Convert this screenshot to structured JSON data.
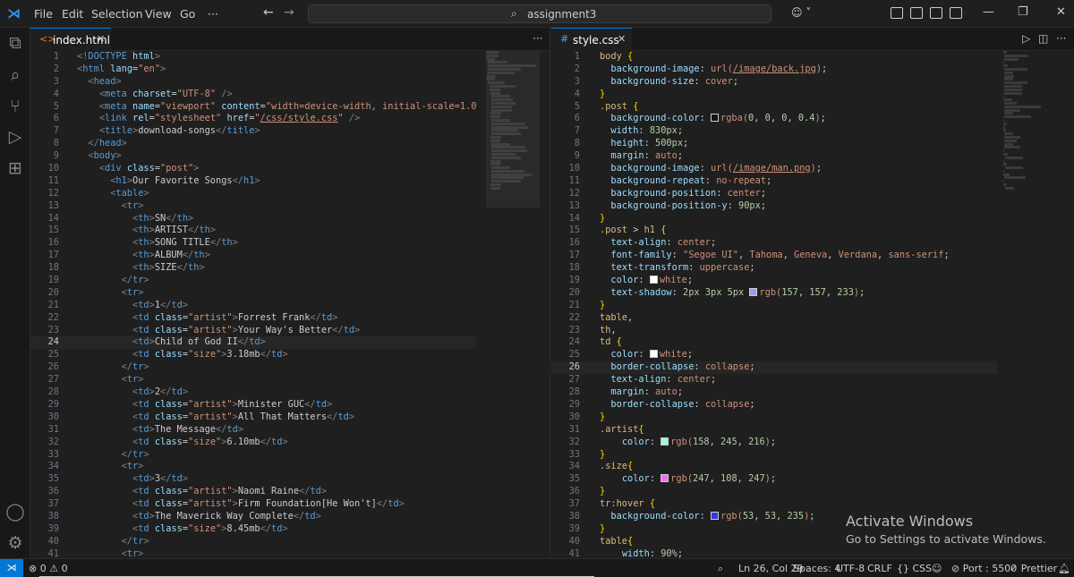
{
  "titlebar": {
    "menu": [
      "File",
      "Edit",
      "Selection",
      "View",
      "Go"
    ],
    "more": "···",
    "search_text": "assignment3",
    "back": "←",
    "forward": "→",
    "controls": {
      "minimize": "—",
      "restore": "❐",
      "close": "✕"
    }
  },
  "left_editor": {
    "tab_label": "index.html",
    "actions": "···",
    "lines": [
      {
        "n": "1",
        "html": "<span class='p'>&lt;!</span><span class='t'>DOCTYPE</span> <span class='a'>html</span><span class='p'>&gt;</span>"
      },
      {
        "n": "2",
        "html": "<span class='p'>&lt;</span><span class='t'>html</span> <span class='a'>lang</span><span class='x'>=</span><span class='s'>\"en\"</span><span class='p'>&gt;</span>"
      },
      {
        "n": "3",
        "html": "  <span class='p'>&lt;</span><span class='t'>head</span><span class='p'>&gt;</span>"
      },
      {
        "n": "4",
        "html": "    <span class='p'>&lt;</span><span class='t'>meta</span> <span class='a'>charset</span><span class='x'>=</span><span class='s'>\"UTF-8\"</span> <span class='p'>/&gt;</span>"
      },
      {
        "n": "5",
        "html": "    <span class='p'>&lt;</span><span class='t'>meta</span> <span class='a'>name</span><span class='x'>=</span><span class='s'>\"viewport\"</span> <span class='a'>content</span><span class='x'>=</span><span class='s'>\"width=device-width, initial-scale=1.0\"</span> <span class='p'>/&gt;</span>"
      },
      {
        "n": "6",
        "html": "    <span class='p'>&lt;</span><span class='t'>link</span> <span class='a'>rel</span><span class='x'>=</span><span class='s'>\"stylesheet\"</span> <span class='a'>href</span><span class='x'>=</span><span class='s'>\"<u>/css/style.css</u>\"</span> <span class='p'>/&gt;</span>"
      },
      {
        "n": "7",
        "html": "    <span class='p'>&lt;</span><span class='t'>title</span><span class='p'>&gt;</span><span class='x'>download-songs</span><span class='p'>&lt;/</span><span class='t'>title</span><span class='p'>&gt;</span>"
      },
      {
        "n": "8",
        "html": "  <span class='p'>&lt;/</span><span class='t'>head</span><span class='p'>&gt;</span>"
      },
      {
        "n": "9",
        "html": "  <span class='p'>&lt;</span><span class='t'>body</span><span class='p'>&gt;</span>"
      },
      {
        "n": "10",
        "html": "    <span class='p'>&lt;</span><span class='t'>div</span> <span class='a'>class</span><span class='x'>=</span><span class='s'>\"post\"</span><span class='p'>&gt;</span>"
      },
      {
        "n": "11",
        "html": "      <span class='p'>&lt;</span><span class='t'>h1</span><span class='p'>&gt;</span><span class='x'>Our Favorite Songs</span><span class='p'>&lt;/</span><span class='t'>h1</span><span class='p'>&gt;</span>"
      },
      {
        "n": "12",
        "html": "      <span class='p'>&lt;</span><span class='t'>table</span><span class='p'>&gt;</span>"
      },
      {
        "n": "13",
        "html": "        <span class='p'>&lt;</span><span class='t'>tr</span><span class='p'>&gt;</span>"
      },
      {
        "n": "14",
        "html": "          <span class='p'>&lt;</span><span class='t'>th</span><span class='p'>&gt;</span><span class='x'>SN</span><span class='p'>&lt;/</span><span class='t'>th</span><span class='p'>&gt;</span>"
      },
      {
        "n": "15",
        "html": "          <span class='p'>&lt;</span><span class='t'>th</span><span class='p'>&gt;</span><span class='x'>ARTIST</span><span class='p'>&lt;/</span><span class='t'>th</span><span class='p'>&gt;</span>"
      },
      {
        "n": "16",
        "html": "          <span class='p'>&lt;</span><span class='t'>th</span><span class='p'>&gt;</span><span class='x'>SONG TITLE</span><span class='p'>&lt;/</span><span class='t'>th</span><span class='p'>&gt;</span>"
      },
      {
        "n": "17",
        "html": "          <span class='p'>&lt;</span><span class='t'>th</span><span class='p'>&gt;</span><span class='x'>ALBUM</span><span class='p'>&lt;/</span><span class='t'>th</span><span class='p'>&gt;</span>"
      },
      {
        "n": "18",
        "html": "          <span class='p'>&lt;</span><span class='t'>th</span><span class='p'>&gt;</span><span class='x'>SIZE</span><span class='p'>&lt;/</span><span class='t'>th</span><span class='p'>&gt;</span>"
      },
      {
        "n": "19",
        "html": "        <span class='p'>&lt;/</span><span class='t'>tr</span><span class='p'>&gt;</span>"
      },
      {
        "n": "20",
        "html": "        <span class='p'>&lt;</span><span class='t'>tr</span><span class='p'>&gt;</span>"
      },
      {
        "n": "21",
        "html": "          <span class='p'>&lt;</span><span class='t'>td</span><span class='p'>&gt;</span><span class='x'>1</span><span class='p'>&lt;/</span><span class='t'>td</span><span class='p'>&gt;</span>"
      },
      {
        "n": "22",
        "html": "          <span class='p'>&lt;</span><span class='t'>td</span> <span class='a'>class</span><span class='x'>=</span><span class='s'>\"artist\"</span><span class='p'>&gt;</span><span class='x'>Forrest Frank</span><span class='p'>&lt;/</span><span class='t'>td</span><span class='p'>&gt;</span>"
      },
      {
        "n": "23",
        "html": "          <span class='p'>&lt;</span><span class='t'>td</span> <span class='a'>class</span><span class='x'>=</span><span class='s'>\"artist\"</span><span class='p'>&gt;</span><span class='x'>Your Way's Better</span><span class='p'>&lt;/</span><span class='t'>td</span><span class='p'>&gt;</span>"
      },
      {
        "n": "24",
        "html": "          <span class='p'>&lt;</span><span class='t'>td</span><span class='p'>&gt;</span><span class='x'>Child of God II</span><span class='p'>&lt;/</span><span class='t'>td</span><span class='p'>&gt;</span>",
        "active": true
      },
      {
        "n": "25",
        "html": "          <span class='p'>&lt;</span><span class='t'>td</span> <span class='a'>class</span><span class='x'>=</span><span class='s'>\"size\"</span><span class='p'>&gt;</span><span class='x'>3.18mb</span><span class='p'>&lt;/</span><span class='t'>td</span><span class='p'>&gt;</span>"
      },
      {
        "n": "26",
        "html": "        <span class='p'>&lt;/</span><span class='t'>tr</span><span class='p'>&gt;</span>"
      },
      {
        "n": "27",
        "html": "        <span class='p'>&lt;</span><span class='t'>tr</span><span class='p'>&gt;</span>"
      },
      {
        "n": "28",
        "html": "          <span class='p'>&lt;</span><span class='t'>td</span><span class='p'>&gt;</span><span class='x'>2</span><span class='p'>&lt;/</span><span class='t'>td</span><span class='p'>&gt;</span>"
      },
      {
        "n": "29",
        "html": "          <span class='p'>&lt;</span><span class='t'>td</span> <span class='a'>class</span><span class='x'>=</span><span class='s'>\"artist\"</span><span class='p'>&gt;</span><span class='x'>Minister GUC</span><span class='p'>&lt;/</span><span class='t'>td</span><span class='p'>&gt;</span>"
      },
      {
        "n": "30",
        "html": "          <span class='p'>&lt;</span><span class='t'>td</span> <span class='a'>class</span><span class='x'>=</span><span class='s'>\"artist\"</span><span class='p'>&gt;</span><span class='x'>All That Matters</span><span class='p'>&lt;/</span><span class='t'>td</span><span class='p'>&gt;</span>"
      },
      {
        "n": "31",
        "html": "          <span class='p'>&lt;</span><span class='t'>td</span><span class='p'>&gt;</span><span class='x'>The Message</span><span class='p'>&lt;/</span><span class='t'>td</span><span class='p'>&gt;</span>"
      },
      {
        "n": "32",
        "html": "          <span class='p'>&lt;</span><span class='t'>td</span> <span class='a'>class</span><span class='x'>=</span><span class='s'>\"size\"</span><span class='p'>&gt;</span><span class='x'>6.10mb</span><span class='p'>&lt;/</span><span class='t'>td</span><span class='p'>&gt;</span>"
      },
      {
        "n": "33",
        "html": "        <span class='p'>&lt;/</span><span class='t'>tr</span><span class='p'>&gt;</span>"
      },
      {
        "n": "34",
        "html": "        <span class='p'>&lt;</span><span class='t'>tr</span><span class='p'>&gt;</span>"
      },
      {
        "n": "35",
        "html": "          <span class='p'>&lt;</span><span class='t'>td</span><span class='p'>&gt;</span><span class='x'>3</span><span class='p'>&lt;/</span><span class='t'>td</span><span class='p'>&gt;</span>"
      },
      {
        "n": "36",
        "html": "          <span class='p'>&lt;</span><span class='t'>td</span> <span class='a'>class</span><span class='x'>=</span><span class='s'>\"artist\"</span><span class='p'>&gt;</span><span class='x'>Naomi Raine</span><span class='p'>&lt;/</span><span class='t'>td</span><span class='p'>&gt;</span>"
      },
      {
        "n": "37",
        "html": "          <span class='p'>&lt;</span><span class='t'>td</span> <span class='a'>class</span><span class='x'>=</span><span class='s'>\"artist\"</span><span class='p'>&gt;</span><span class='x'>Firm Foundation[He Won't]</span><span class='p'>&lt;/</span><span class='t'>td</span><span class='p'>&gt;</span>"
      },
      {
        "n": "38",
        "html": "          <span class='p'>&lt;</span><span class='t'>td</span><span class='p'>&gt;</span><span class='x'>The Maverick Way Complete</span><span class='p'>&lt;/</span><span class='t'>td</span><span class='p'>&gt;</span>"
      },
      {
        "n": "39",
        "html": "          <span class='p'>&lt;</span><span class='t'>td</span> <span class='a'>class</span><span class='x'>=</span><span class='s'>\"size\"</span><span class='p'>&gt;</span><span class='x'>8.45mb</span><span class='p'>&lt;/</span><span class='t'>td</span><span class='p'>&gt;</span>"
      },
      {
        "n": "40",
        "html": "        <span class='p'>&lt;/</span><span class='t'>tr</span><span class='p'>&gt;</span>"
      },
      {
        "n": "41",
        "html": "        <span class='p'>&lt;</span><span class='t'>tr</span><span class='p'>&gt;</span>"
      }
    ]
  },
  "right_editor": {
    "tab_label": "style.css",
    "lines": [
      {
        "n": "1",
        "html": "<span class='sel'>body</span> <span class='y'>{</span>"
      },
      {
        "n": "2",
        "html": "  <span class='a'>background-image</span><span class='x'>: </span><span class='v'>url(<u>/image/back.jpg</u>)</span><span class='x'>;</span>"
      },
      {
        "n": "3",
        "html": "  <span class='a'>background-size</span><span class='x'>: </span><span class='v'>cover</span><span class='x'>;</span>"
      },
      {
        "n": "4",
        "html": "<span class='y'>}</span>"
      },
      {
        "n": "5",
        "html": "<span class='sel'>.post</span> <span class='y'>{</span>"
      },
      {
        "n": "6",
        "html": "  <span class='a'>background-color</span><span class='x'>: </span><span class='sw' style='background:rgba(0,0,0,0.4)'></span><span class='v'>rgba(</span><span class='n'>0</span><span class='x'>, </span><span class='n'>0</span><span class='x'>, </span><span class='n'>0</span><span class='x'>, </span><span class='n'>0.4</span><span class='v'>)</span><span class='x'>;</span>"
      },
      {
        "n": "7",
        "html": "  <span class='a'>width</span><span class='x'>: </span><span class='n'>830px</span><span class='x'>;</span>"
      },
      {
        "n": "8",
        "html": "  <span class='a'>height</span><span class='x'>: </span><span class='n'>500px</span><span class='x'>;</span>"
      },
      {
        "n": "9",
        "html": "  <span class='a'>margin</span><span class='x'>: </span><span class='v'>auto</span><span class='x'>;</span>"
      },
      {
        "n": "10",
        "html": "  <span class='a'>background-image</span><span class='x'>: </span><span class='v'>url(<u>/image/man.png</u>)</span><span class='x'>;</span>"
      },
      {
        "n": "11",
        "html": "  <span class='a'>background-repeat</span><span class='x'>: </span><span class='v'>no-repeat</span><span class='x'>;</span>"
      },
      {
        "n": "12",
        "html": "  <span class='a'>background-position</span><span class='x'>: </span><span class='v'>center</span><span class='x'>;</span>"
      },
      {
        "n": "13",
        "html": "  <span class='a'>background-position-y</span><span class='x'>: </span><span class='n'>90px</span><span class='x'>;</span>"
      },
      {
        "n": "14",
        "html": "<span class='y'>}</span>"
      },
      {
        "n": "15",
        "html": "<span class='sel'>.post</span> <span class='x'>&gt;</span> <span class='sel'>h1</span> <span class='y'>{</span>"
      },
      {
        "n": "16",
        "html": "  <span class='a'>text-align</span><span class='x'>: </span><span class='v'>center</span><span class='x'>;</span>"
      },
      {
        "n": "17",
        "html": "  <span class='a'>font-family</span><span class='x'>: </span><span class='s'>\"Segoe UI\"</span><span class='x'>, </span><span class='v'>Tahoma</span><span class='x'>, </span><span class='v'>Geneva</span><span class='x'>, </span><span class='v'>Verdana</span><span class='x'>, </span><span class='v'>sans-serif</span><span class='x'>;</span>"
      },
      {
        "n": "18",
        "html": "  <span class='a'>text-transform</span><span class='x'>: </span><span class='v'>uppercase</span><span class='x'>;</span>"
      },
      {
        "n": "19",
        "html": "  <span class='a'>color</span><span class='x'>: </span><span class='sw' style='background:#ffffff'></span><span class='v'>white</span><span class='x'>;</span>"
      },
      {
        "n": "20",
        "html": "  <span class='a'>text-shadow</span><span class='x'>: </span><span class='n'>2px</span> <span class='n'>3px</span> <span class='n'>5px</span> <span class='sw' style='background:rgb(157,157,233)'></span><span class='v'>rgb(</span><span class='n'>157</span><span class='x'>, </span><span class='n'>157</span><span class='x'>, </span><span class='n'>233</span><span class='v'>)</span><span class='x'>;</span>"
      },
      {
        "n": "21",
        "html": "<span class='y'>}</span>"
      },
      {
        "n": "22",
        "html": "<span class='sel'>table</span><span class='x'>,</span>"
      },
      {
        "n": "23",
        "html": "<span class='sel'>th</span><span class='x'>,</span>"
      },
      {
        "n": "24",
        "html": "<span class='sel'>td</span> <span class='y'>{</span>"
      },
      {
        "n": "25",
        "html": "  <span class='a'>color</span><span class='x'>: </span><span class='sw' style='background:#ffffff'></span><span class='v'>white</span><span class='x'>;</span>"
      },
      {
        "n": "26",
        "html": "  <span class='a'>border-collapse</span><span class='x'>: </span><span class='v'>collapse</span><span class='x'>;</span>",
        "active": true
      },
      {
        "n": "27",
        "html": "  <span class='a'>text-align</span><span class='x'>: </span><span class='v'>center</span><span class='x'>;</span>"
      },
      {
        "n": "28",
        "html": "  <span class='a'>margin</span><span class='x'>: </span><span class='v'>auto</span><span class='x'>;</span>"
      },
      {
        "n": "29",
        "html": "  <span class='a'>border-collapse</span><span class='x'>: </span><span class='v'>collapse</span><span class='x'>;</span>"
      },
      {
        "n": "30",
        "html": "<span class='y'>}</span>"
      },
      {
        "n": "31",
        "html": "<span class='sel'>.artist</span><span class='y'>{</span>"
      },
      {
        "n": "32",
        "html": "    <span class='a'>color</span><span class='x'>: </span><span class='sw' style='background:rgb(158,245,216)'></span><span class='v'>rgb(</span><span class='n'>158</span><span class='x'>, </span><span class='n'>245</span><span class='x'>, </span><span class='n'>216</span><span class='v'>)</span><span class='x'>;</span>"
      },
      {
        "n": "33",
        "html": "<span class='y'>}</span>"
      },
      {
        "n": "34",
        "html": "<span class='sel'>.size</span><span class='y'>{</span>"
      },
      {
        "n": "35",
        "html": "    <span class='a'>color</span><span class='x'>: </span><span class='sw' style='background:rgb(247,108,247)'></span><span class='v'>rgb(</span><span class='n'>247</span><span class='x'>, </span><span class='n'>108</span><span class='x'>, </span><span class='n'>247</span><span class='v'>)</span><span class='x'>;</span>"
      },
      {
        "n": "36",
        "html": "<span class='y'>}</span>"
      },
      {
        "n": "37",
        "html": "<span class='sel'>tr:hover</span> <span class='y'>{</span>"
      },
      {
        "n": "38",
        "html": "  <span class='a'>background-color</span><span class='x'>: </span><span class='sw' style='background:rgb(53,53,235)'></span><span class='v'>rgb(</span><span class='n'>53</span><span class='x'>, </span><span class='n'>53</span><span class='x'>, </span><span class='n'>235</span><span class='v'>)</span><span class='x'>;</span>"
      },
      {
        "n": "39",
        "html": "<span class='y'>}</span>"
      },
      {
        "n": "40",
        "html": "<span class='sel'>table</span><span class='y'>{</span>"
      },
      {
        "n": "41",
        "html": "    <span class='a'>width</span><span class='x'>: </span><span class='n'>90%</span><span class='x'>;</span>"
      }
    ]
  },
  "watermark": {
    "title": "Activate Windows",
    "subtitle": "Go to Settings to activate Windows."
  },
  "statusbar": {
    "problems": "⊗ 0 ⚠ 0",
    "cursor": "Ln 26, Col 29",
    "spaces": "Spaces: 4",
    "encoding": "UTF-8",
    "eol": "CRLF",
    "language": "{} CSS",
    "port": "⊘ Port : 5500",
    "prettier": "✓ Prettier"
  },
  "colors": {
    "accent": "#0078d4",
    "editor_bg": "#1f1f1f"
  }
}
